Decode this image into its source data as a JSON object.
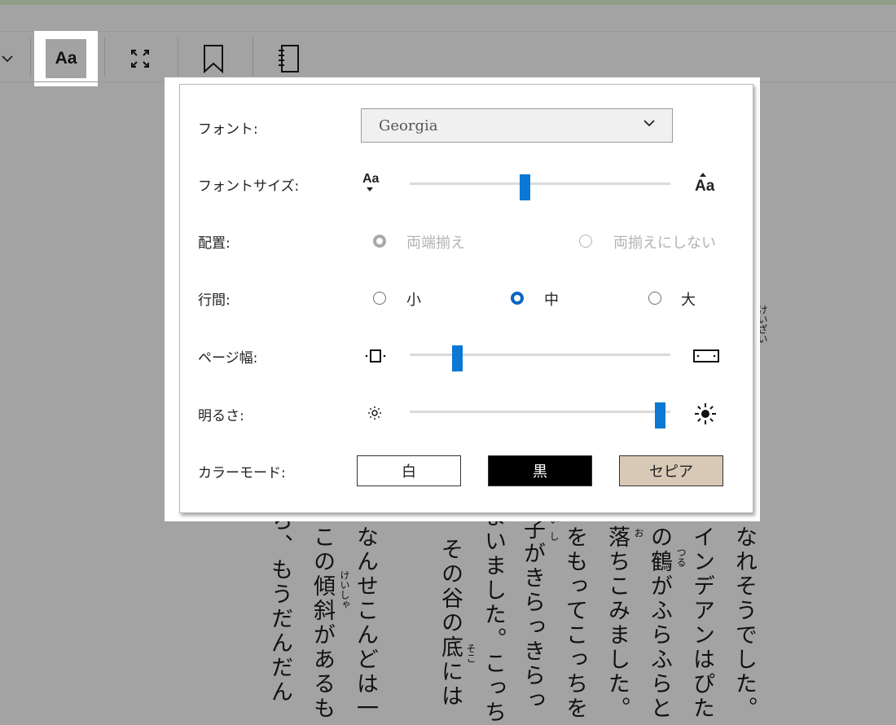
{
  "toolbar": {
    "font_button_label": "Aa"
  },
  "settings": {
    "font": {
      "label": "フォント:",
      "value": "Georgia"
    },
    "font_size": {
      "label": "フォントサイズ:",
      "small_icon_text": "Aa",
      "large_icon_text": "Aa",
      "level": 0.44
    },
    "alignment": {
      "label": "配置:",
      "options": [
        {
          "label": "両端揃え",
          "selected": true,
          "disabled": true
        },
        {
          "label": "両揃えにしない",
          "selected": false,
          "disabled": true
        }
      ]
    },
    "line_spacing": {
      "label": "行間:",
      "options": [
        {
          "label": "小",
          "selected": false
        },
        {
          "label": "中",
          "selected": true
        },
        {
          "label": "大",
          "selected": false
        }
      ]
    },
    "page_width": {
      "label": "ページ幅:",
      "level": 0.17
    },
    "brightness": {
      "label": "明るさ:",
      "level": 0.98
    },
    "color_mode": {
      "label": "カラーモード:",
      "options": [
        {
          "label": "白",
          "bg": "#ffffff",
          "fg": "#222222"
        },
        {
          "label": "黒",
          "bg": "#000000",
          "fg": "#ffffff"
        },
        {
          "label": "セピア",
          "bg": "#d8c8b6",
          "fg": "#222222"
        }
      ]
    }
  },
  "accent_color": "#0a78d4",
  "reader_text": {
    "columns": [
      "ら、もうだんだん",
      "この傾斜があるも",
      "なんせこんどは一",
      "、その谷の底には",
      "まいました。こっち",
      "子がきらっきらっ",
      "をもってこっちを",
      "落ちこみました。",
      "の鶴がふらふらと",
      "インデアンはぴた",
      "なれそうでした。"
    ],
    "rubies": [
      "けいしゃ",
      "そこ",
      "い",
      "し",
      "お",
      "つる",
      "けいざい"
    ]
  }
}
